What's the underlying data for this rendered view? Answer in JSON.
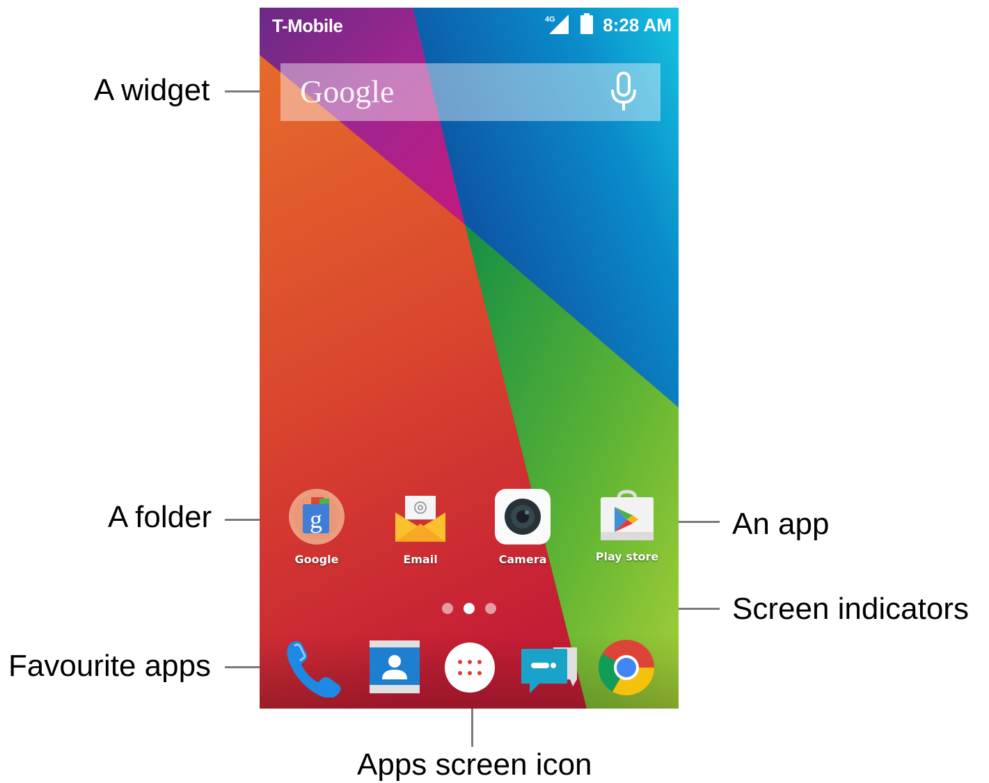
{
  "status_bar": {
    "carrier": "T-Mobile",
    "network": "4G",
    "time": "8:28 AM"
  },
  "search_widget": {
    "logo_text": "Google",
    "mic_icon": "microphone-icon"
  },
  "home_apps": [
    {
      "label": "Google",
      "icon": "google-folder-icon"
    },
    {
      "label": "Email",
      "icon": "email-icon"
    },
    {
      "label": "Camera",
      "icon": "camera-icon"
    },
    {
      "label": "Play store",
      "icon": "play-store-icon"
    }
  ],
  "screen_indicators": {
    "count": 3,
    "active_index": 1
  },
  "dock": [
    {
      "icon": "phone-icon"
    },
    {
      "icon": "contacts-icon"
    },
    {
      "icon": "apps-launcher-icon"
    },
    {
      "icon": "messaging-icon"
    },
    {
      "icon": "chrome-icon"
    }
  ],
  "callouts": {
    "widget": "A widget",
    "folder": "A folder",
    "favourite_apps": "Favourite apps",
    "an_app": "An app",
    "screen_indicators": "Screen indicators",
    "apps_screen_icon": "Apps screen icon"
  }
}
